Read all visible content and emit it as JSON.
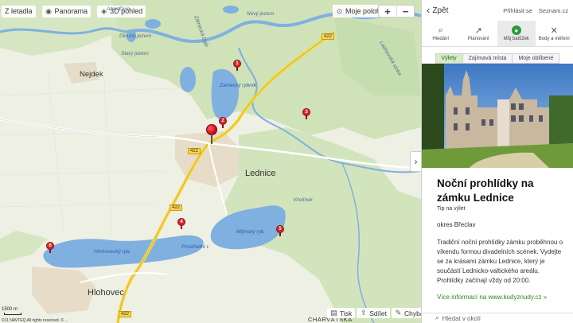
{
  "map": {
    "toolbar": {
      "aerial_label": "Z letadla",
      "panorama_label": "Panorama",
      "view3d_label": "3D pohled",
      "my_location_label": "Moje poloha",
      "zoom_in": "+",
      "zoom_out": "−"
    },
    "labels": {
      "nejdek": "Nejdek",
      "lednice": "Lednice",
      "hlohovec": "Hlohovec",
      "charvatska": "CHARVÁTSKÁ",
      "zamecky": "Zámecký rybník",
      "mlynsky": "Mlýnský ryb.",
      "prostredni": "Prostřední r.",
      "hlohovecky": "Hlohovecký ryb.",
      "road_422_a": "422",
      "road_422_b": "422",
      "road_422_c": "422",
      "road_422_d": "422",
      "dyje": "Dyje",
      "zamecka_dyje": "Zámecká Dyje",
      "ladnovska": "Ladnovská stoka",
      "novy_jezero": "Nový jezero",
      "dlouhe": "Dlouhé jezero",
      "stary": "Starý jezero",
      "vcelinek": "Včelínek",
      "azard": "Azard"
    },
    "pins": [
      "1",
      "2",
      "3",
      "4",
      "5",
      "6"
    ],
    "bottom": {
      "print_label": "Tisk",
      "share_label": "Sdílet",
      "error_label": "Chyba?"
    },
    "scale_label": "1500 m",
    "copyright": "©11 NAVTEQ All rights reserved, © ..."
  },
  "panel": {
    "back_label": "Zpět",
    "login_label": "Přihlásit se",
    "seznam_label": "Seznam.cz",
    "nav": [
      {
        "label": "Hledání",
        "icon": "search-icon"
      },
      {
        "label": "Plánování",
        "icon": "route-icon"
      },
      {
        "label": "Můj batůžek",
        "icon": "backpack-icon"
      },
      {
        "label": "Body a měření",
        "icon": "measure-icon"
      }
    ],
    "tabs": [
      "Výlety",
      "Zajímavá místa",
      "Moje oblíbené"
    ],
    "title": "Noční prohlídky na zámku Lednice",
    "subtitle": "Tip na výlet",
    "district": "okres Břeclav",
    "description": "Tradiční noční prohlídky zámku proběhnou o víkendu formou divadelních scének. Vydejte se za krásami zámku Lednice, který je součástí Lednicko-valtického areálu. Prohlídky začínají vždy od 20:00.",
    "more_link": "Více informací na www.kudyznudy.cz »",
    "search_placeholder": "Hledat v okolí"
  },
  "colors": {
    "water": "#7fb0e0",
    "forest": "#cfe2b8",
    "road_main": "#f7d84a",
    "pin": "#d9262c",
    "accent_green": "#2f9a3c"
  }
}
